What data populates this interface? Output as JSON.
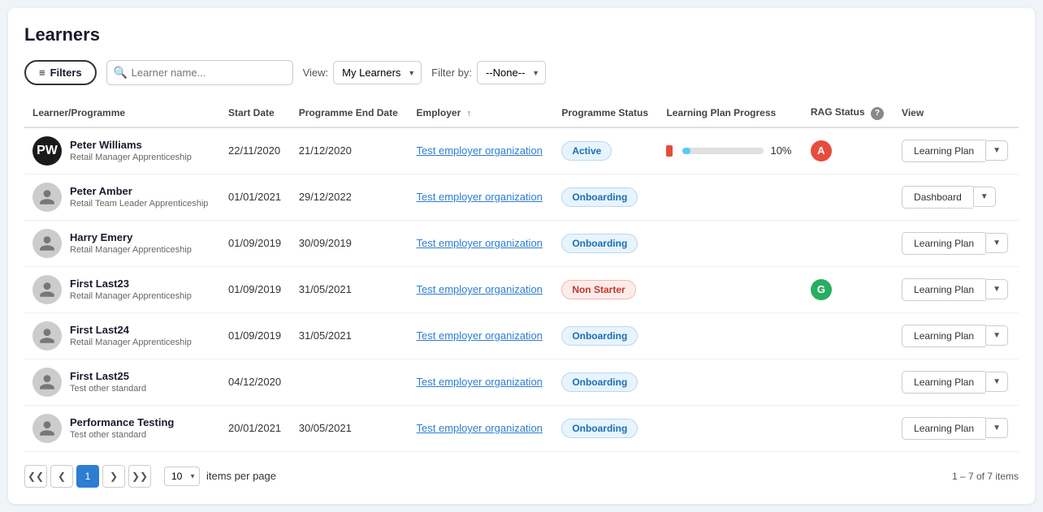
{
  "page": {
    "title": "Learners"
  },
  "toolbar": {
    "filters_label": "Filters",
    "search_placeholder": "Learner name...",
    "view_label": "View:",
    "view_option": "My Learners",
    "filter_label": "Filter by:",
    "filter_option": "--None--"
  },
  "table": {
    "columns": [
      "Learner/Programme",
      "Start Date",
      "Programme End Date",
      "Employer",
      "Programme Status",
      "Learning Plan Progress",
      "RAG Status",
      "View"
    ],
    "rows": [
      {
        "name": "Peter Williams",
        "programme": "Retail Manager Apprenticeship",
        "start_date": "22/11/2020",
        "end_date": "21/12/2020",
        "employer": "Test employer organization",
        "status": "Active",
        "status_type": "active",
        "progress": 10,
        "rag": "A",
        "rag_type": "a",
        "view_label": "Learning Plan",
        "avatar_type": "black"
      },
      {
        "name": "Peter Amber",
        "programme": "Retail Team Leader Apprenticeship",
        "start_date": "01/01/2021",
        "end_date": "29/12/2022",
        "employer": "Test employer organization",
        "status": "Onboarding",
        "status_type": "onboarding",
        "progress": null,
        "rag": "",
        "rag_type": "",
        "view_label": "Dashboard",
        "avatar_type": "default"
      },
      {
        "name": "Harry Emery",
        "programme": "Retail Manager Apprenticeship",
        "start_date": "01/09/2019",
        "end_date": "30/09/2019",
        "employer": "Test employer organization",
        "status": "Onboarding",
        "status_type": "onboarding",
        "progress": null,
        "rag": "",
        "rag_type": "",
        "view_label": "Learning Plan",
        "avatar_type": "default"
      },
      {
        "name": "First Last23",
        "programme": "Retail Manager Apprenticeship",
        "start_date": "01/09/2019",
        "end_date": "31/05/2021",
        "employer": "Test employer organization",
        "status": "Non Starter",
        "status_type": "non-starter",
        "progress": null,
        "rag": "G",
        "rag_type": "g",
        "view_label": "Learning Plan",
        "avatar_type": "default"
      },
      {
        "name": "First Last24",
        "programme": "Retail Manager Apprenticeship",
        "start_date": "01/09/2019",
        "end_date": "31/05/2021",
        "employer": "Test employer organization",
        "status": "Onboarding",
        "status_type": "onboarding",
        "progress": null,
        "rag": "",
        "rag_type": "",
        "view_label": "Learning Plan",
        "avatar_type": "default"
      },
      {
        "name": "First Last25",
        "programme": "Test other standard",
        "start_date": "04/12/2020",
        "end_date": "",
        "employer": "Test employer organization",
        "status": "Onboarding",
        "status_type": "onboarding",
        "progress": null,
        "rag": "",
        "rag_type": "",
        "view_label": "Learning Plan",
        "avatar_type": "default"
      },
      {
        "name": "Performance Testing",
        "programme": "Test other standard",
        "start_date": "20/01/2021",
        "end_date": "30/05/2021",
        "employer": "Test employer organization",
        "status": "Onboarding",
        "status_type": "onboarding",
        "progress": null,
        "rag": "",
        "rag_type": "",
        "view_label": "Learning Plan",
        "avatar_type": "default"
      }
    ]
  },
  "pagination": {
    "current_page": 1,
    "per_page": 10,
    "items_info": "1 – 7 of 7 items",
    "items_per_page_label": "items per page"
  },
  "icons": {
    "filter": "≡",
    "search": "🔍",
    "sort_up": "↑",
    "chevron_down": "▼",
    "help": "?",
    "first_page": "◀◀",
    "prev_page": "◀",
    "next_page": "▶",
    "last_page": "▶▶"
  }
}
